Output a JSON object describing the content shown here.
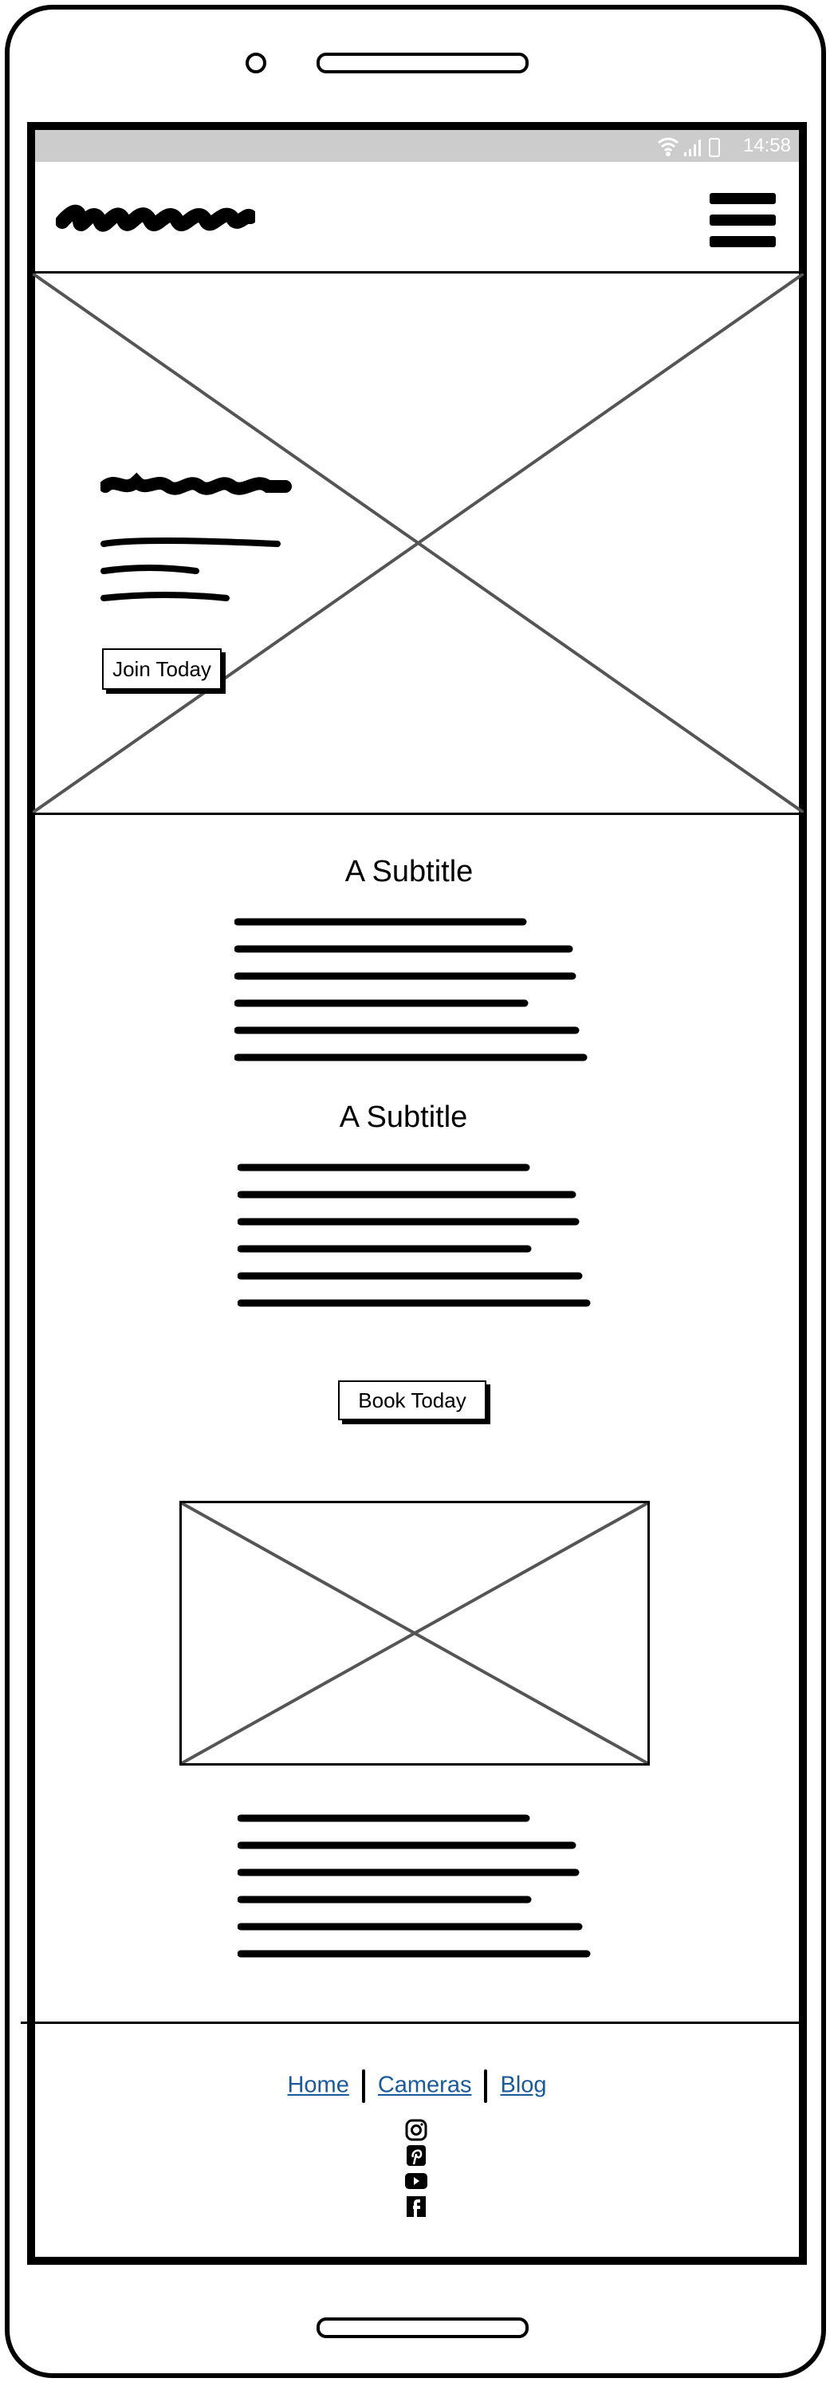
{
  "status_bar": {
    "time": "14:58",
    "icons": [
      "wifi-icon",
      "signal-icon",
      "battery-icon"
    ]
  },
  "header": {
    "logo": "scribble-logo",
    "menu_icon": "hamburger-icon"
  },
  "hero": {
    "button_label": "Join Today"
  },
  "sections": [
    {
      "subtitle": "A Subtitle"
    },
    {
      "subtitle": "A Subtitle"
    }
  ],
  "cta": {
    "button_label": "Book Today"
  },
  "footer": {
    "links": [
      {
        "label": "Home"
      },
      {
        "label": "Cameras"
      },
      {
        "label": "Blog"
      }
    ],
    "link_color": "#1a5a9a",
    "social_icons": [
      "instagram-icon",
      "pinterest-icon",
      "youtube-icon",
      "facebook-icon"
    ]
  }
}
